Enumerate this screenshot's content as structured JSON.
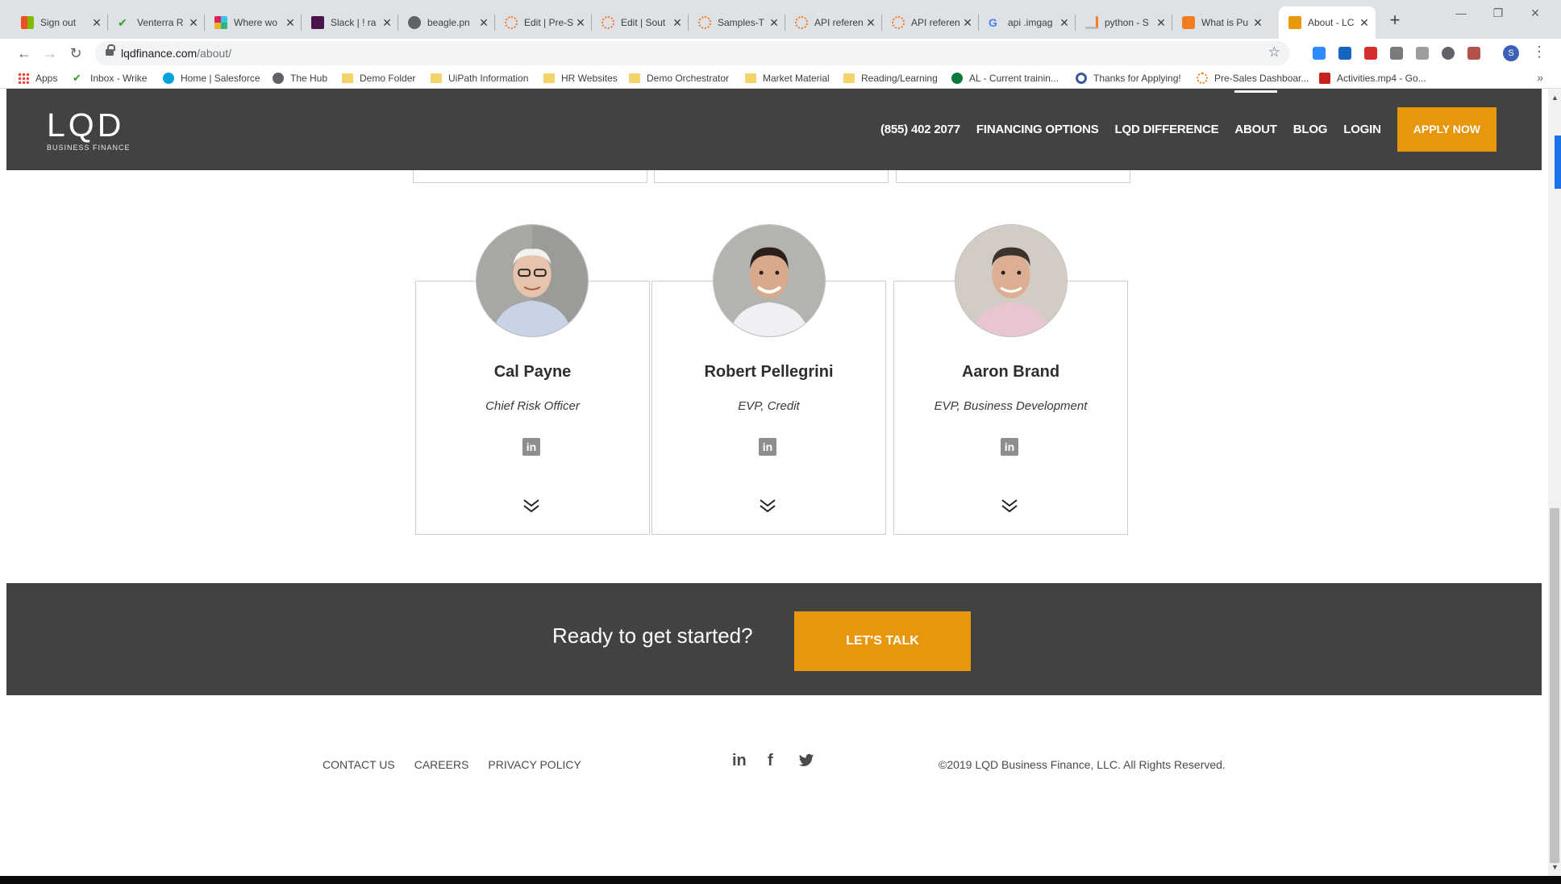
{
  "browser": {
    "tabs": [
      {
        "label": "Sign out",
        "favicon_color": "#f25022"
      },
      {
        "label": "Venterra R",
        "favicon_color": "#29a329"
      },
      {
        "label": "Where wo",
        "favicon_color": "#e01e5a"
      },
      {
        "label": "Slack | ! ra",
        "favicon_color": "#4a154b"
      },
      {
        "label": "beagle.pn",
        "favicon_color": "#5f6368"
      },
      {
        "label": "Edit | Pre-S",
        "favicon_color": "#f47b20"
      },
      {
        "label": "Edit | Sout",
        "favicon_color": "#f47b20"
      },
      {
        "label": "Samples-T",
        "favicon_color": "#f47b20"
      },
      {
        "label": "API referen",
        "favicon_color": "#f47b20"
      },
      {
        "label": "API referen",
        "favicon_color": "#f47b20"
      },
      {
        "label": "api .imgag",
        "favicon_color": "#4285f4"
      },
      {
        "label": "python - S",
        "favicon_color": "#f48024"
      },
      {
        "label": "What is Pu",
        "favicon_color": "#f47b20"
      },
      {
        "label": "About - LC",
        "favicon_color": "#e8960c"
      }
    ],
    "close_glyph": "✕",
    "new_tab_glyph": "+",
    "url_domain": "lqdfinance.com",
    "url_path": "/about/",
    "profile_initial": "S",
    "bookmarks": [
      {
        "label": "Apps",
        "type": "apps"
      },
      {
        "label": "Inbox - Wrike",
        "type": "icon",
        "color": "#29a329"
      },
      {
        "label": "Home | Salesforce",
        "type": "icon",
        "color": "#00a1e0"
      },
      {
        "label": "The Hub",
        "type": "icon",
        "color": "#5f6368"
      },
      {
        "label": "Demo Folder",
        "type": "folder"
      },
      {
        "label": "UiPath Information",
        "type": "folder"
      },
      {
        "label": "HR Websites",
        "type": "folder"
      },
      {
        "label": "Demo Orchestrator",
        "type": "folder"
      },
      {
        "label": "Market Material",
        "type": "folder"
      },
      {
        "label": "Reading/Learning",
        "type": "folder"
      },
      {
        "label": "AL - Current trainin...",
        "type": "icon",
        "color": "#0b7a3b"
      },
      {
        "label": "Thanks for Applying!",
        "type": "icon",
        "color": "#3b5998"
      },
      {
        "label": "Pre-Sales Dashboar...",
        "type": "icon",
        "color": "#f47b20"
      },
      {
        "label": "Activities.mp4 - Go...",
        "type": "icon",
        "color": "#c5221f"
      }
    ],
    "bookmarks_overflow": "»"
  },
  "site": {
    "logo_text": "LQD",
    "logo_sub": "BUSINESS FINANCE",
    "nav": {
      "phone": "(855) 402 2077",
      "financing": "FINANCING OPTIONS",
      "difference": "LQD DIFFERENCE",
      "about": "ABOUT",
      "blog": "BLOG",
      "login": "LOGIN",
      "apply": "APPLY NOW"
    },
    "team": [
      {
        "name": "Cal Payne",
        "title": "Chief Risk Officer",
        "linkedin": "in"
      },
      {
        "name": "Robert Pellegrini",
        "title": "EVP, Credit",
        "linkedin": "in"
      },
      {
        "name": "Aaron Brand",
        "title": "EVP, Business Development",
        "linkedin": "in"
      }
    ],
    "cta": {
      "text": "Ready to get started?",
      "button": "LET'S TALK"
    },
    "footer": {
      "links": [
        "CONTACT US",
        "CAREERS",
        "PRIVACY POLICY"
      ],
      "social": {
        "linkedin": "in",
        "facebook": "f",
        "twitter": "twitter"
      },
      "copyright": "©2019 LQD Business Finance, LLC. All Rights Reserved."
    },
    "colors": {
      "header": "#424242",
      "accent": "#e8960c"
    }
  }
}
